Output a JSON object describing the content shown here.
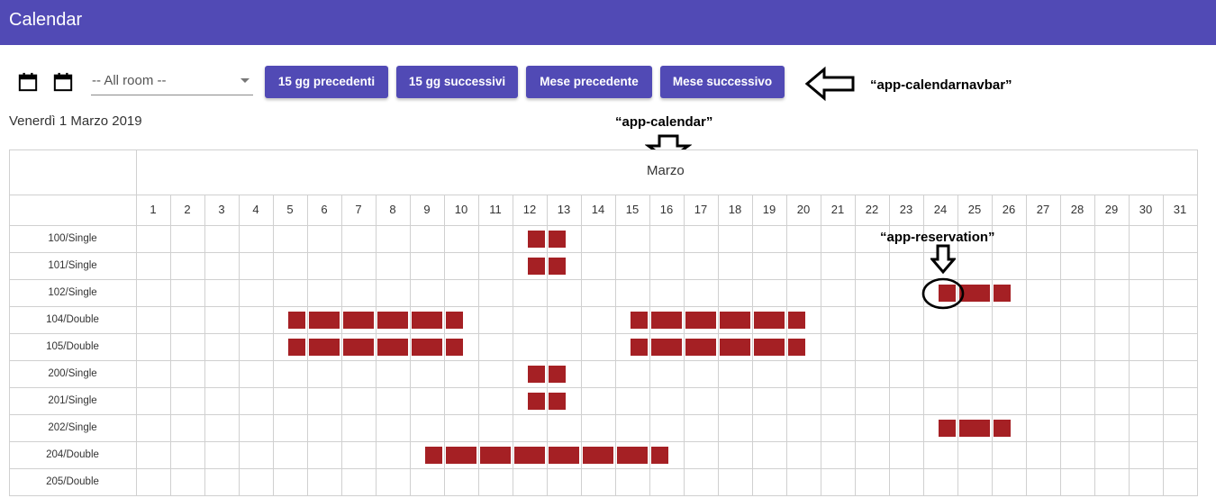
{
  "header": {
    "title": "Calendar"
  },
  "navbar": {
    "room_select": {
      "value": "-- All room --"
    },
    "buttons": [
      "15 gg precedenti",
      "15 gg successivi",
      "Mese precedente",
      "Mese successivo"
    ]
  },
  "annotations": {
    "navbar": "“app-calendarnavbar”",
    "calendar": "“app-calendar”",
    "reservation": "“app-reservation”"
  },
  "current_date": "Venerdì 1 Marzo 2019",
  "calendar": {
    "month": "Marzo",
    "days": [
      "1",
      "2",
      "3",
      "4",
      "5",
      "6",
      "7",
      "8",
      "9",
      "10",
      "11",
      "12",
      "13",
      "14",
      "15",
      "16",
      "17",
      "18",
      "19",
      "20",
      "21",
      "22",
      "23",
      "24",
      "25",
      "26",
      "27",
      "28",
      "29",
      "30",
      "31"
    ],
    "rooms": [
      {
        "name": "100/Single",
        "reservations": [
          [
            12,
            13
          ]
        ]
      },
      {
        "name": "101/Single",
        "reservations": [
          [
            12,
            13
          ]
        ]
      },
      {
        "name": "102/Single",
        "reservations": [
          [
            24,
            26
          ]
        ]
      },
      {
        "name": "104/Double",
        "reservations": [
          [
            5,
            10
          ],
          [
            15,
            20
          ]
        ]
      },
      {
        "name": "105/Double",
        "reservations": [
          [
            5,
            10
          ],
          [
            15,
            20
          ]
        ]
      },
      {
        "name": "200/Single",
        "reservations": [
          [
            12,
            13
          ]
        ]
      },
      {
        "name": "201/Single",
        "reservations": [
          [
            12,
            13
          ]
        ]
      },
      {
        "name": "202/Single",
        "reservations": [
          [
            24,
            26
          ]
        ]
      },
      {
        "name": "204/Double",
        "reservations": [
          [
            9,
            11
          ],
          [
            11,
            14
          ],
          [
            14,
            16
          ]
        ]
      },
      {
        "name": "205/Double",
        "reservations": []
      }
    ]
  },
  "colors": {
    "primary": "#514ab5",
    "reservation": "#a52024",
    "grid": "#d0d0d0"
  },
  "icons": [
    "calendar-icon",
    "calendar-icon",
    "chevron-down-icon",
    "arrow-left-icon",
    "arrow-down-icon"
  ]
}
